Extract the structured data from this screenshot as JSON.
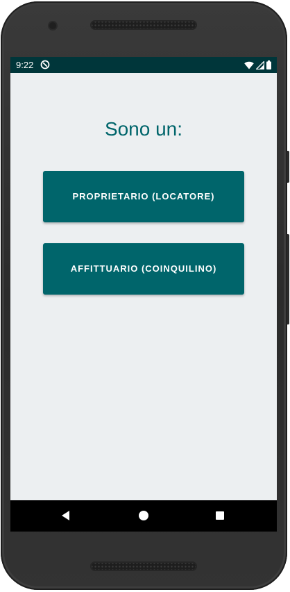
{
  "status_bar": {
    "time": "9:22",
    "icons": [
      "sync-icon",
      "wifi-icon",
      "signal-icon",
      "battery-icon"
    ]
  },
  "main": {
    "title": "Sono un:",
    "buttons": [
      {
        "label": "PROPRIETARIO (LOCATORE)"
      },
      {
        "label": "AFFITTUARIO (COINQUILINO)"
      }
    ]
  },
  "navigation_bar": {
    "icons": [
      "back-icon",
      "home-icon",
      "recents-icon"
    ]
  },
  "colors": {
    "status_bar": "#00363a",
    "primary": "#00656b",
    "background": "#eceff1",
    "navigation_bar": "#000000"
  }
}
